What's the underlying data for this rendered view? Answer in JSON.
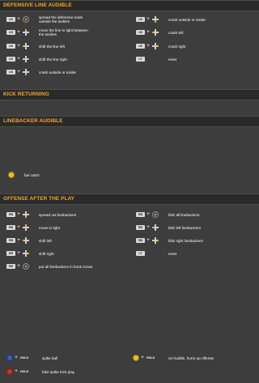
{
  "sections": {
    "defensive_line": {
      "title": "DEFENSIVE LINE AUDIBLE",
      "left": [
        {
          "btn": "LB",
          "extra": "stick",
          "dir": "",
          "label1": "spread the defensive ends",
          "label2": "outside the tackles"
        },
        {
          "btn": "LB",
          "extra": "dpad",
          "dir": "up",
          "label1": "move the line in tight between",
          "label2": "the tackles"
        },
        {
          "btn": "LB",
          "extra": "dpad",
          "dir": "left",
          "label1": "shift the line left",
          "label2": ""
        },
        {
          "btn": "LB",
          "extra": "dpad",
          "dir": "right",
          "label1": "shift the line right",
          "label2": ""
        },
        {
          "btn": "LB",
          "extra": "dpad",
          "dir": "down",
          "label1": "crash outside or inside",
          "label2": ""
        }
      ],
      "right": [
        {
          "btn": "LB",
          "extra": "dpad",
          "dir": "down",
          "label1": "crash outside or inside"
        },
        {
          "btn": "LB",
          "extra": "dpad",
          "dir": "left",
          "label1": "crash left"
        },
        {
          "btn": "LB",
          "extra": "dpad",
          "dir": "right",
          "label1": "crash right"
        },
        {
          "btn": "LT",
          "extra": "",
          "dir": "",
          "label1": "reset"
        }
      ]
    },
    "kick_returning": {
      "title": "KICK RETURNING",
      "rows": [
        {
          "btn": "Y",
          "label1": "fair catch"
        }
      ]
    },
    "linebacker": {
      "title": "LINEBACKER AUDIBLE",
      "left": [
        {
          "btn": "RB",
          "dir": "down",
          "label1": "spread out linebackers"
        },
        {
          "btn": "RB",
          "dir": "up",
          "label1": "move in tight"
        },
        {
          "btn": "RB",
          "dir": "left",
          "label1": "shift left"
        },
        {
          "btn": "RB",
          "dir": "right",
          "label1": "shift right"
        },
        {
          "btn": "RB",
          "dir": "center",
          "label1": "put all linebackers in hook zones"
        }
      ],
      "right": [
        {
          "btn": "RB",
          "extra": "stick",
          "label1": "blitz all linebackers"
        },
        {
          "btn": "RB",
          "extra": "dpad",
          "label1": "blitz left linebackers"
        },
        {
          "btn": "RB",
          "extra": "dpad",
          "label1": "blitz right linebackers"
        },
        {
          "btn": "LT",
          "extra": "",
          "label1": "reset"
        }
      ]
    },
    "offense_after": {
      "title": "OFFENSE AFTER THE PLAY",
      "left": [
        {
          "btn": "X",
          "hold": "HOLD",
          "label1": "spike ball"
        },
        {
          "btn": "B",
          "hold": "HOLD",
          "label1": "fake spike trick play"
        }
      ],
      "right": [
        {
          "btn": "Y",
          "hold": "HOLD",
          "label1": "no huddle, hurry-up offense"
        }
      ]
    }
  },
  "symbols": {
    "plus": "+"
  },
  "colors": {
    "accent": "#f5a623",
    "background": "#3d3d3d",
    "header_bg": "#2a2a2a"
  }
}
